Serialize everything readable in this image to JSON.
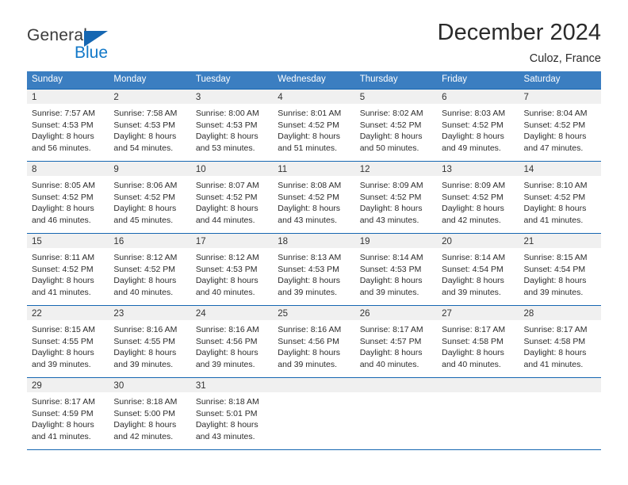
{
  "brand": {
    "name_part1": "General",
    "name_part2": "Blue",
    "triangle_color": "#1667b2",
    "blue_color": "#1278c8"
  },
  "header": {
    "title": "December 2024",
    "subtitle": "Culoz, France"
  },
  "theme": {
    "header_bg": "#3b7ec1",
    "rule_color": "#1667b2",
    "daynum_bg": "#f0f0f0",
    "text_color": "#2c2c2c"
  },
  "weekdays": [
    "Sunday",
    "Monday",
    "Tuesday",
    "Wednesday",
    "Thursday",
    "Friday",
    "Saturday"
  ],
  "labels": {
    "sunrise_prefix": "Sunrise:",
    "sunset_prefix": "Sunset:",
    "daylight_prefix": "Daylight:"
  },
  "weeks": [
    [
      {
        "day": "1",
        "sunrise": "Sunrise: 7:57 AM",
        "sunset": "Sunset: 4:53 PM",
        "daylight1": "Daylight: 8 hours",
        "daylight2": "and 56 minutes."
      },
      {
        "day": "2",
        "sunrise": "Sunrise: 7:58 AM",
        "sunset": "Sunset: 4:53 PM",
        "daylight1": "Daylight: 8 hours",
        "daylight2": "and 54 minutes."
      },
      {
        "day": "3",
        "sunrise": "Sunrise: 8:00 AM",
        "sunset": "Sunset: 4:53 PM",
        "daylight1": "Daylight: 8 hours",
        "daylight2": "and 53 minutes."
      },
      {
        "day": "4",
        "sunrise": "Sunrise: 8:01 AM",
        "sunset": "Sunset: 4:52 PM",
        "daylight1": "Daylight: 8 hours",
        "daylight2": "and 51 minutes."
      },
      {
        "day": "5",
        "sunrise": "Sunrise: 8:02 AM",
        "sunset": "Sunset: 4:52 PM",
        "daylight1": "Daylight: 8 hours",
        "daylight2": "and 50 minutes."
      },
      {
        "day": "6",
        "sunrise": "Sunrise: 8:03 AM",
        "sunset": "Sunset: 4:52 PM",
        "daylight1": "Daylight: 8 hours",
        "daylight2": "and 49 minutes."
      },
      {
        "day": "7",
        "sunrise": "Sunrise: 8:04 AM",
        "sunset": "Sunset: 4:52 PM",
        "daylight1": "Daylight: 8 hours",
        "daylight2": "and 47 minutes."
      }
    ],
    [
      {
        "day": "8",
        "sunrise": "Sunrise: 8:05 AM",
        "sunset": "Sunset: 4:52 PM",
        "daylight1": "Daylight: 8 hours",
        "daylight2": "and 46 minutes."
      },
      {
        "day": "9",
        "sunrise": "Sunrise: 8:06 AM",
        "sunset": "Sunset: 4:52 PM",
        "daylight1": "Daylight: 8 hours",
        "daylight2": "and 45 minutes."
      },
      {
        "day": "10",
        "sunrise": "Sunrise: 8:07 AM",
        "sunset": "Sunset: 4:52 PM",
        "daylight1": "Daylight: 8 hours",
        "daylight2": "and 44 minutes."
      },
      {
        "day": "11",
        "sunrise": "Sunrise: 8:08 AM",
        "sunset": "Sunset: 4:52 PM",
        "daylight1": "Daylight: 8 hours",
        "daylight2": "and 43 minutes."
      },
      {
        "day": "12",
        "sunrise": "Sunrise: 8:09 AM",
        "sunset": "Sunset: 4:52 PM",
        "daylight1": "Daylight: 8 hours",
        "daylight2": "and 43 minutes."
      },
      {
        "day": "13",
        "sunrise": "Sunrise: 8:09 AM",
        "sunset": "Sunset: 4:52 PM",
        "daylight1": "Daylight: 8 hours",
        "daylight2": "and 42 minutes."
      },
      {
        "day": "14",
        "sunrise": "Sunrise: 8:10 AM",
        "sunset": "Sunset: 4:52 PM",
        "daylight1": "Daylight: 8 hours",
        "daylight2": "and 41 minutes."
      }
    ],
    [
      {
        "day": "15",
        "sunrise": "Sunrise: 8:11 AM",
        "sunset": "Sunset: 4:52 PM",
        "daylight1": "Daylight: 8 hours",
        "daylight2": "and 41 minutes."
      },
      {
        "day": "16",
        "sunrise": "Sunrise: 8:12 AM",
        "sunset": "Sunset: 4:52 PM",
        "daylight1": "Daylight: 8 hours",
        "daylight2": "and 40 minutes."
      },
      {
        "day": "17",
        "sunrise": "Sunrise: 8:12 AM",
        "sunset": "Sunset: 4:53 PM",
        "daylight1": "Daylight: 8 hours",
        "daylight2": "and 40 minutes."
      },
      {
        "day": "18",
        "sunrise": "Sunrise: 8:13 AM",
        "sunset": "Sunset: 4:53 PM",
        "daylight1": "Daylight: 8 hours",
        "daylight2": "and 39 minutes."
      },
      {
        "day": "19",
        "sunrise": "Sunrise: 8:14 AM",
        "sunset": "Sunset: 4:53 PM",
        "daylight1": "Daylight: 8 hours",
        "daylight2": "and 39 minutes."
      },
      {
        "day": "20",
        "sunrise": "Sunrise: 8:14 AM",
        "sunset": "Sunset: 4:54 PM",
        "daylight1": "Daylight: 8 hours",
        "daylight2": "and 39 minutes."
      },
      {
        "day": "21",
        "sunrise": "Sunrise: 8:15 AM",
        "sunset": "Sunset: 4:54 PM",
        "daylight1": "Daylight: 8 hours",
        "daylight2": "and 39 minutes."
      }
    ],
    [
      {
        "day": "22",
        "sunrise": "Sunrise: 8:15 AM",
        "sunset": "Sunset: 4:55 PM",
        "daylight1": "Daylight: 8 hours",
        "daylight2": "and 39 minutes."
      },
      {
        "day": "23",
        "sunrise": "Sunrise: 8:16 AM",
        "sunset": "Sunset: 4:55 PM",
        "daylight1": "Daylight: 8 hours",
        "daylight2": "and 39 minutes."
      },
      {
        "day": "24",
        "sunrise": "Sunrise: 8:16 AM",
        "sunset": "Sunset: 4:56 PM",
        "daylight1": "Daylight: 8 hours",
        "daylight2": "and 39 minutes."
      },
      {
        "day": "25",
        "sunrise": "Sunrise: 8:16 AM",
        "sunset": "Sunset: 4:56 PM",
        "daylight1": "Daylight: 8 hours",
        "daylight2": "and 39 minutes."
      },
      {
        "day": "26",
        "sunrise": "Sunrise: 8:17 AM",
        "sunset": "Sunset: 4:57 PM",
        "daylight1": "Daylight: 8 hours",
        "daylight2": "and 40 minutes."
      },
      {
        "day": "27",
        "sunrise": "Sunrise: 8:17 AM",
        "sunset": "Sunset: 4:58 PM",
        "daylight1": "Daylight: 8 hours",
        "daylight2": "and 40 minutes."
      },
      {
        "day": "28",
        "sunrise": "Sunrise: 8:17 AM",
        "sunset": "Sunset: 4:58 PM",
        "daylight1": "Daylight: 8 hours",
        "daylight2": "and 41 minutes."
      }
    ],
    [
      {
        "day": "29",
        "sunrise": "Sunrise: 8:17 AM",
        "sunset": "Sunset: 4:59 PM",
        "daylight1": "Daylight: 8 hours",
        "daylight2": "and 41 minutes."
      },
      {
        "day": "30",
        "sunrise": "Sunrise: 8:18 AM",
        "sunset": "Sunset: 5:00 PM",
        "daylight1": "Daylight: 8 hours",
        "daylight2": "and 42 minutes."
      },
      {
        "day": "31",
        "sunrise": "Sunrise: 8:18 AM",
        "sunset": "Sunset: 5:01 PM",
        "daylight1": "Daylight: 8 hours",
        "daylight2": "and 43 minutes."
      },
      {
        "day": "",
        "sunrise": "",
        "sunset": "",
        "daylight1": "",
        "daylight2": ""
      },
      {
        "day": "",
        "sunrise": "",
        "sunset": "",
        "daylight1": "",
        "daylight2": ""
      },
      {
        "day": "",
        "sunrise": "",
        "sunset": "",
        "daylight1": "",
        "daylight2": ""
      },
      {
        "day": "",
        "sunrise": "",
        "sunset": "",
        "daylight1": "",
        "daylight2": ""
      }
    ]
  ]
}
